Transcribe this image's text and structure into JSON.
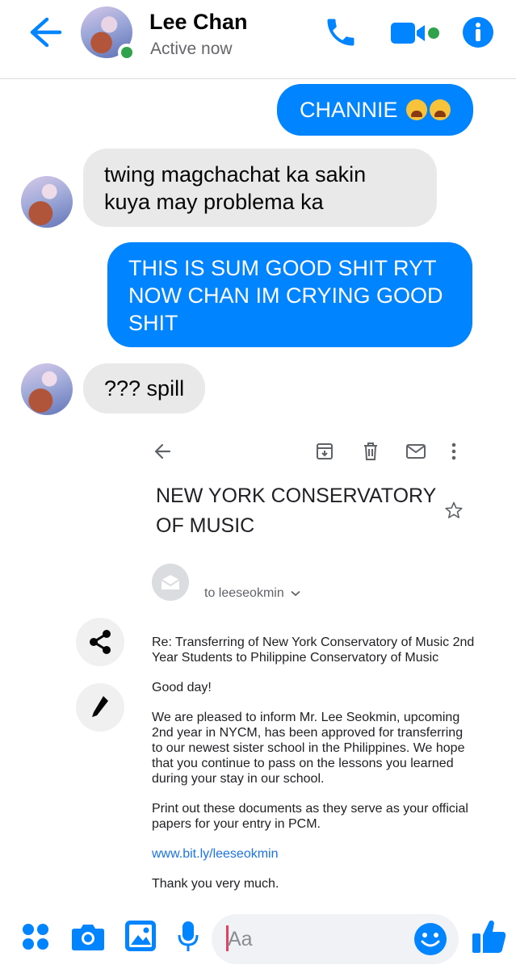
{
  "header": {
    "contact_name": "Lee Chan",
    "status": "Active now"
  },
  "messages": [
    {
      "direction": "outgoing",
      "text": "CHANNIE"
    },
    {
      "direction": "incoming",
      "text": "twing magchachat ka sakin kuya may problema ka"
    },
    {
      "direction": "outgoing",
      "text": "THIS IS SUM GOOD SHIT RYT NOW CHAN IM CRYING GOOD SHIT"
    },
    {
      "direction": "incoming",
      "text": "??? spill"
    }
  ],
  "email": {
    "subject": "NEW YORK CONSERVATORY OF MUSIC",
    "to": "to leeseokmin",
    "re_line": "Re: Transferring of New York Conservatory of Music 2nd Year Students to Philippine Conservatory of Music",
    "greeting": "Good day!",
    "paragraph1": "We are pleased to inform Mr. Lee Seokmin, upcoming 2nd year in NYCM, has been approved for transferring to our newest sister school in the Philippines. We hope that you continue to pass on the lessons you learned during your stay in our school.",
    "paragraph2": "Print out these documents as they serve as your official papers for your entry in PCM.",
    "link": "www.bit.ly/leeseokmin",
    "closing": "Thank you very much."
  },
  "composer": {
    "placeholder": "Aa"
  },
  "colors": {
    "accent": "#0084ff",
    "incoming_bubble": "#e9e9ea",
    "presence": "#31a24c"
  }
}
